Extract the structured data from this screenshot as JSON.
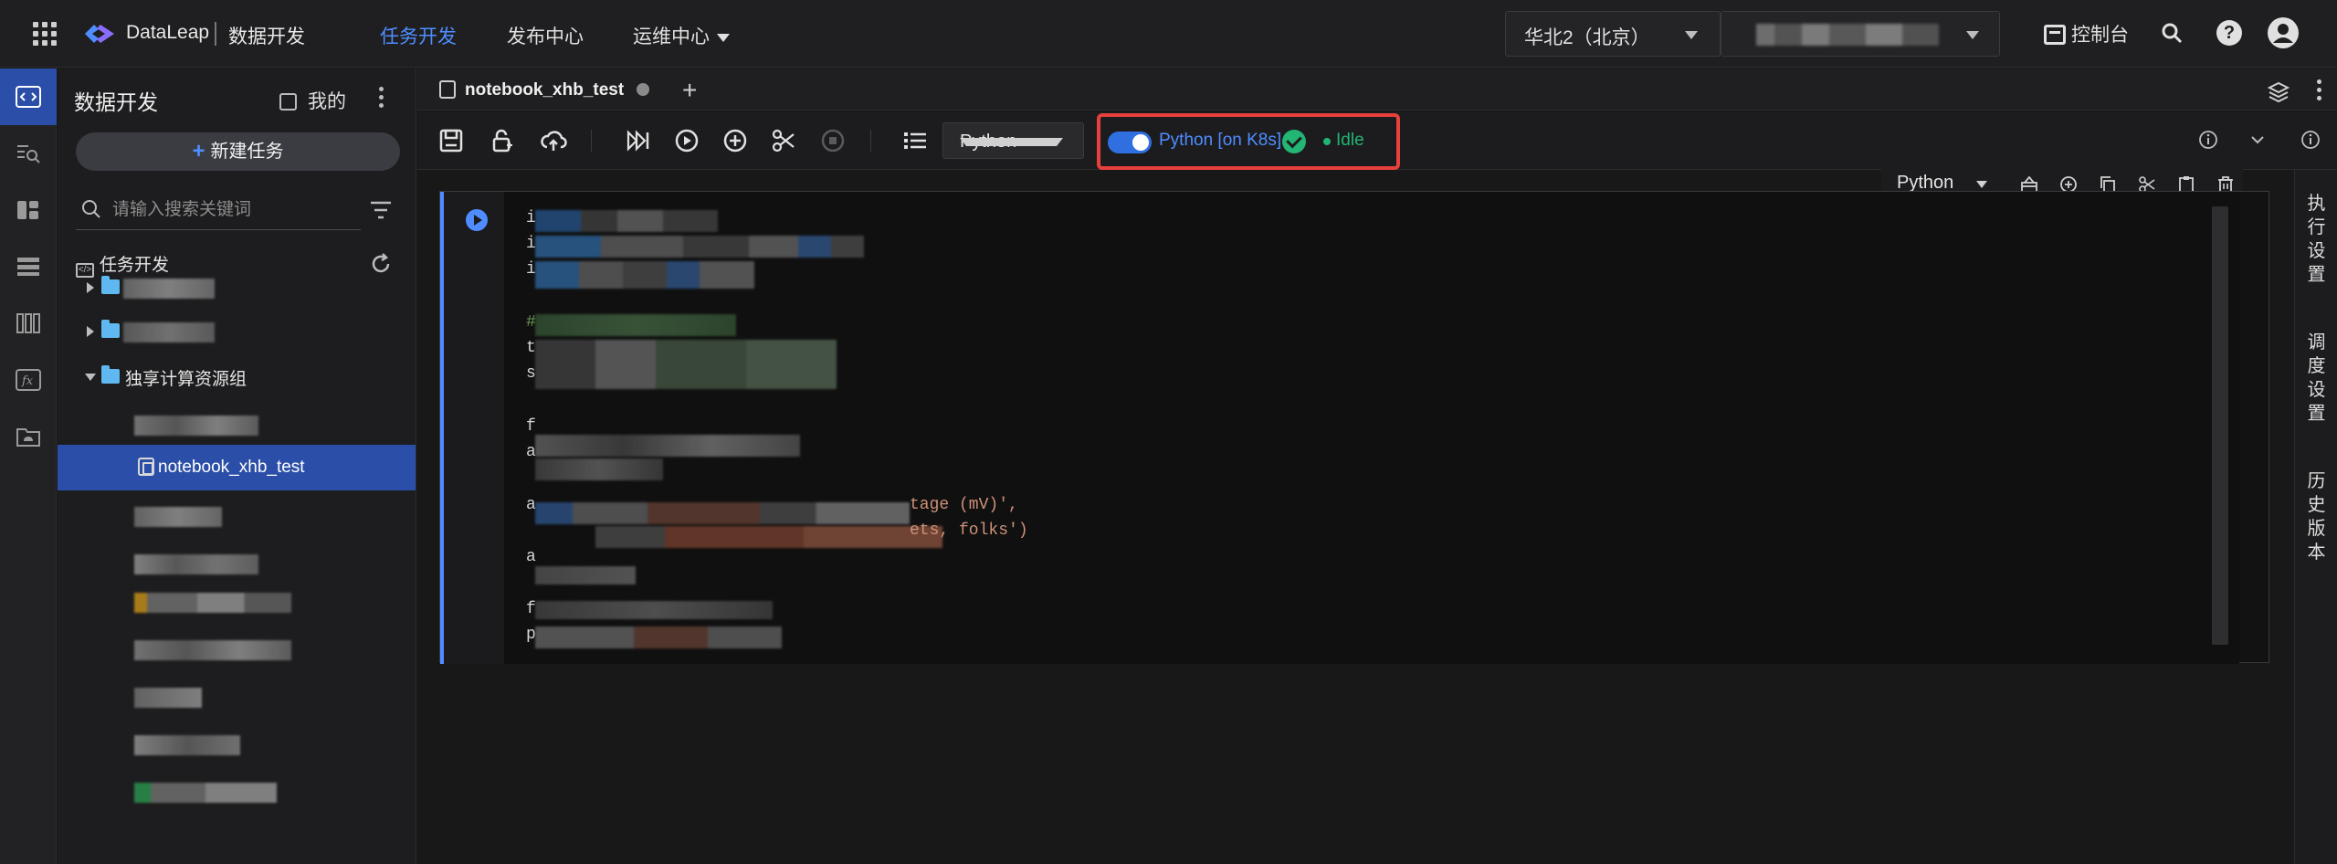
{
  "header": {
    "brand": "DataLeap",
    "product": "数据开发",
    "nav": [
      {
        "label": "任务开发",
        "active": true
      },
      {
        "label": "发布中心",
        "active": false
      },
      {
        "label": "运维中心",
        "active": false
      }
    ],
    "region": "华北2（北京）",
    "console_label": "控制台",
    "help_glyph": "?"
  },
  "sidebar": {
    "title": "数据开发",
    "mine_label": "我的",
    "new_task_label": "新建任务",
    "search_placeholder": "请输入搜索关键词",
    "tree_root": "任务开发",
    "tree_root_icon": "</>",
    "folder_group": "独享计算资源组",
    "selected_notebook": "notebook_xhb_test"
  },
  "tabs": [
    {
      "label": "notebook_xhb_test",
      "modified": true
    }
  ],
  "toolbar": {
    "language": "Python",
    "kernel_name": "Python [on K8s]",
    "kernel_status": "Idle",
    "kernel_connected": true
  },
  "cell": {
    "language": "Python",
    "visible_code_fragments": {
      "line_starts": [
        "i",
        "i",
        "i",
        "#",
        "t",
        "s",
        "f",
        "a",
        "a",
        "a",
        "f",
        "p"
      ],
      "string_fragment_1": "tage (mV)',",
      "string_fragment_2": "ets, folks')"
    }
  },
  "right_panel": {
    "items": [
      "执行设置",
      "调度设置",
      "历史版本"
    ]
  },
  "colors": {
    "accent": "#4f8dff",
    "selected_bg": "#2b4fa8",
    "status_ok": "#22b573",
    "highlight_border": "#e8403c",
    "folder": "#5fb8ef"
  }
}
